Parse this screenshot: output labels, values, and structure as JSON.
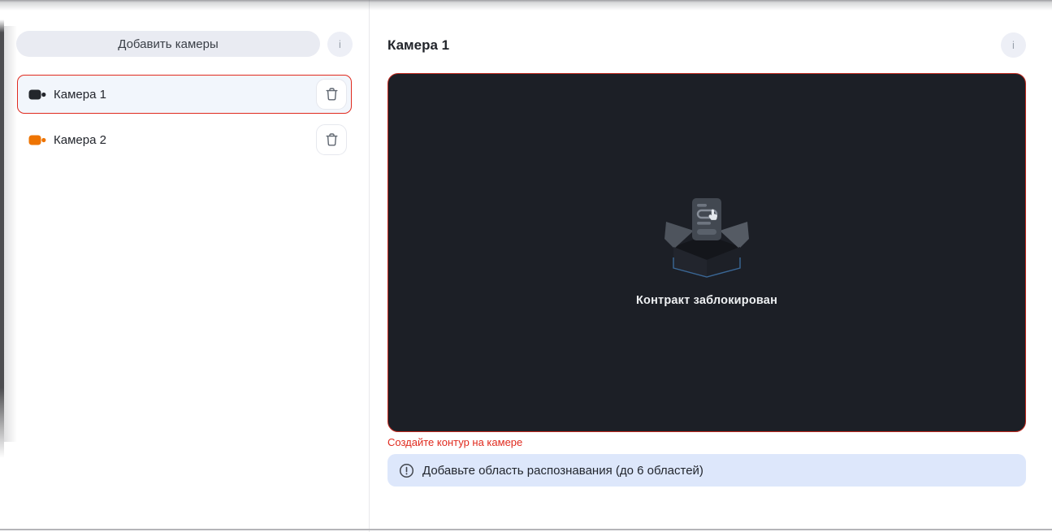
{
  "sidebar": {
    "add_button": "Добавить камеры",
    "info_button": "i",
    "cameras": [
      {
        "name": "Камера 1",
        "icon_color": "#23262c",
        "selected": true
      },
      {
        "name": "Камера 2",
        "icon_color": "#ee7402",
        "selected": false
      }
    ]
  },
  "main": {
    "title": "Камера 1",
    "info_button": "i",
    "placeholder_message": "Контракт заблокирован",
    "error_text": "Создайте контур на камере",
    "banner_text": "Добавьте область распознавания (до 6 областей)"
  },
  "colors": {
    "error_red": "#e02a1e",
    "selected_item_bg": "#f2f6fc",
    "banner_bg": "#dde7fb",
    "video_panel_bg": "#1c1f26",
    "camera1_icon": "#23262c",
    "camera2_icon": "#ee7402"
  }
}
